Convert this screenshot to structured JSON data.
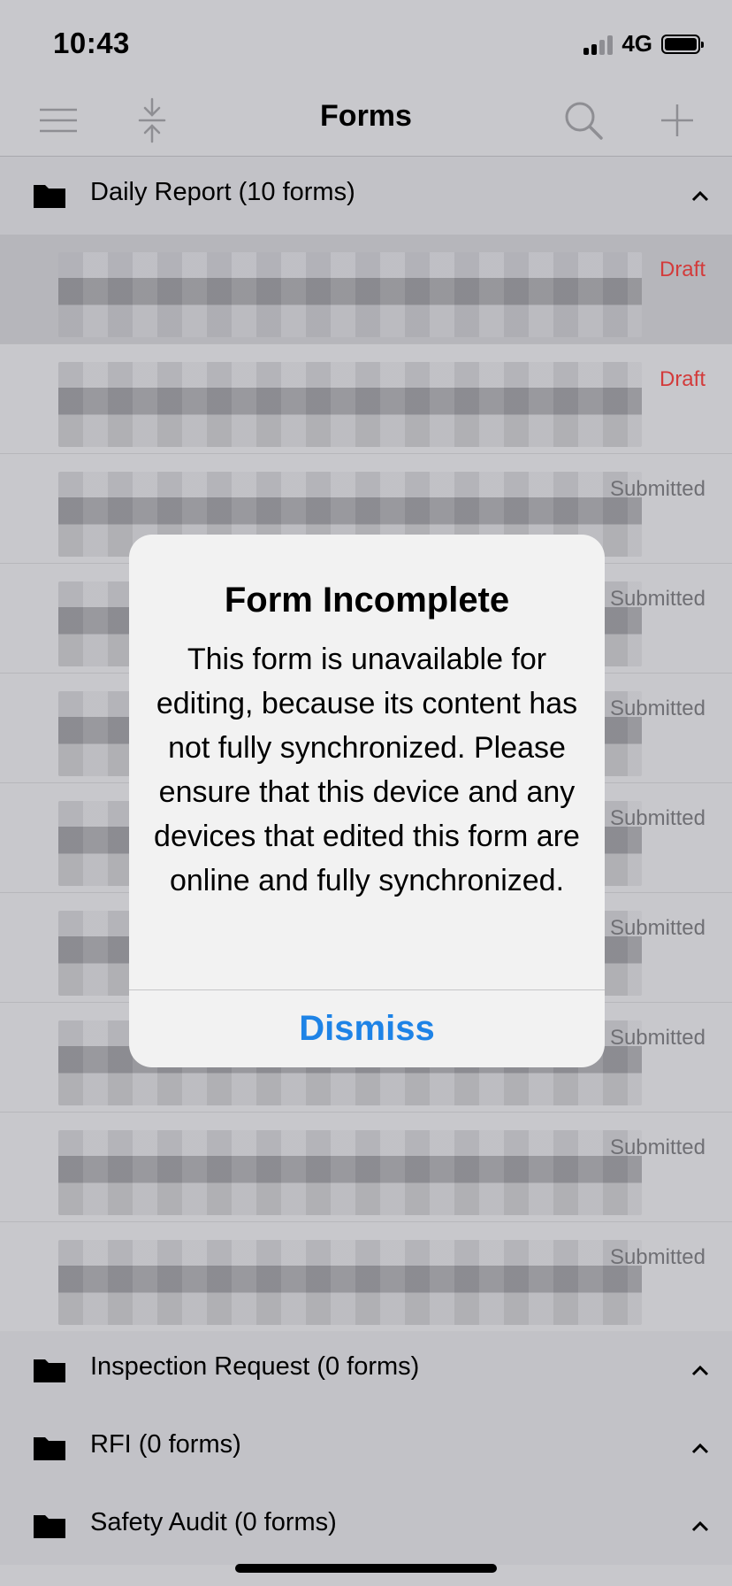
{
  "status_bar": {
    "time": "10:43",
    "network": "4G"
  },
  "nav": {
    "title": "Forms"
  },
  "sections": [
    {
      "label": "Daily Report (10 forms)"
    },
    {
      "label": "Inspection Request (0 forms)"
    },
    {
      "label": "RFI (0 forms)"
    },
    {
      "label": "Safety Audit (0 forms)"
    }
  ],
  "rows": [
    {
      "status": "Draft"
    },
    {
      "status": "Draft"
    },
    {
      "status": "Submitted"
    },
    {
      "status": "Submitted"
    },
    {
      "status": "Submitted"
    },
    {
      "status": "Submitted"
    },
    {
      "status": "Submitted"
    },
    {
      "status": "Submitted"
    },
    {
      "status": "Submitted"
    },
    {
      "status": "Submitted"
    }
  ],
  "dialog": {
    "title": "Form Incomplete",
    "message": "This form is unavailable for editing, because its content has not fully synchronized. Please ensure that this device and any devices that edited this form are online and fully synchronized.",
    "button": "Dismiss"
  },
  "colors": {
    "accent": "#1e83e6",
    "draft": "#d33b3b"
  },
  "icons": [
    "menu-icon",
    "collapse-icon",
    "search-icon",
    "add-icon",
    "folder-icon",
    "chevron-up-icon"
  ]
}
